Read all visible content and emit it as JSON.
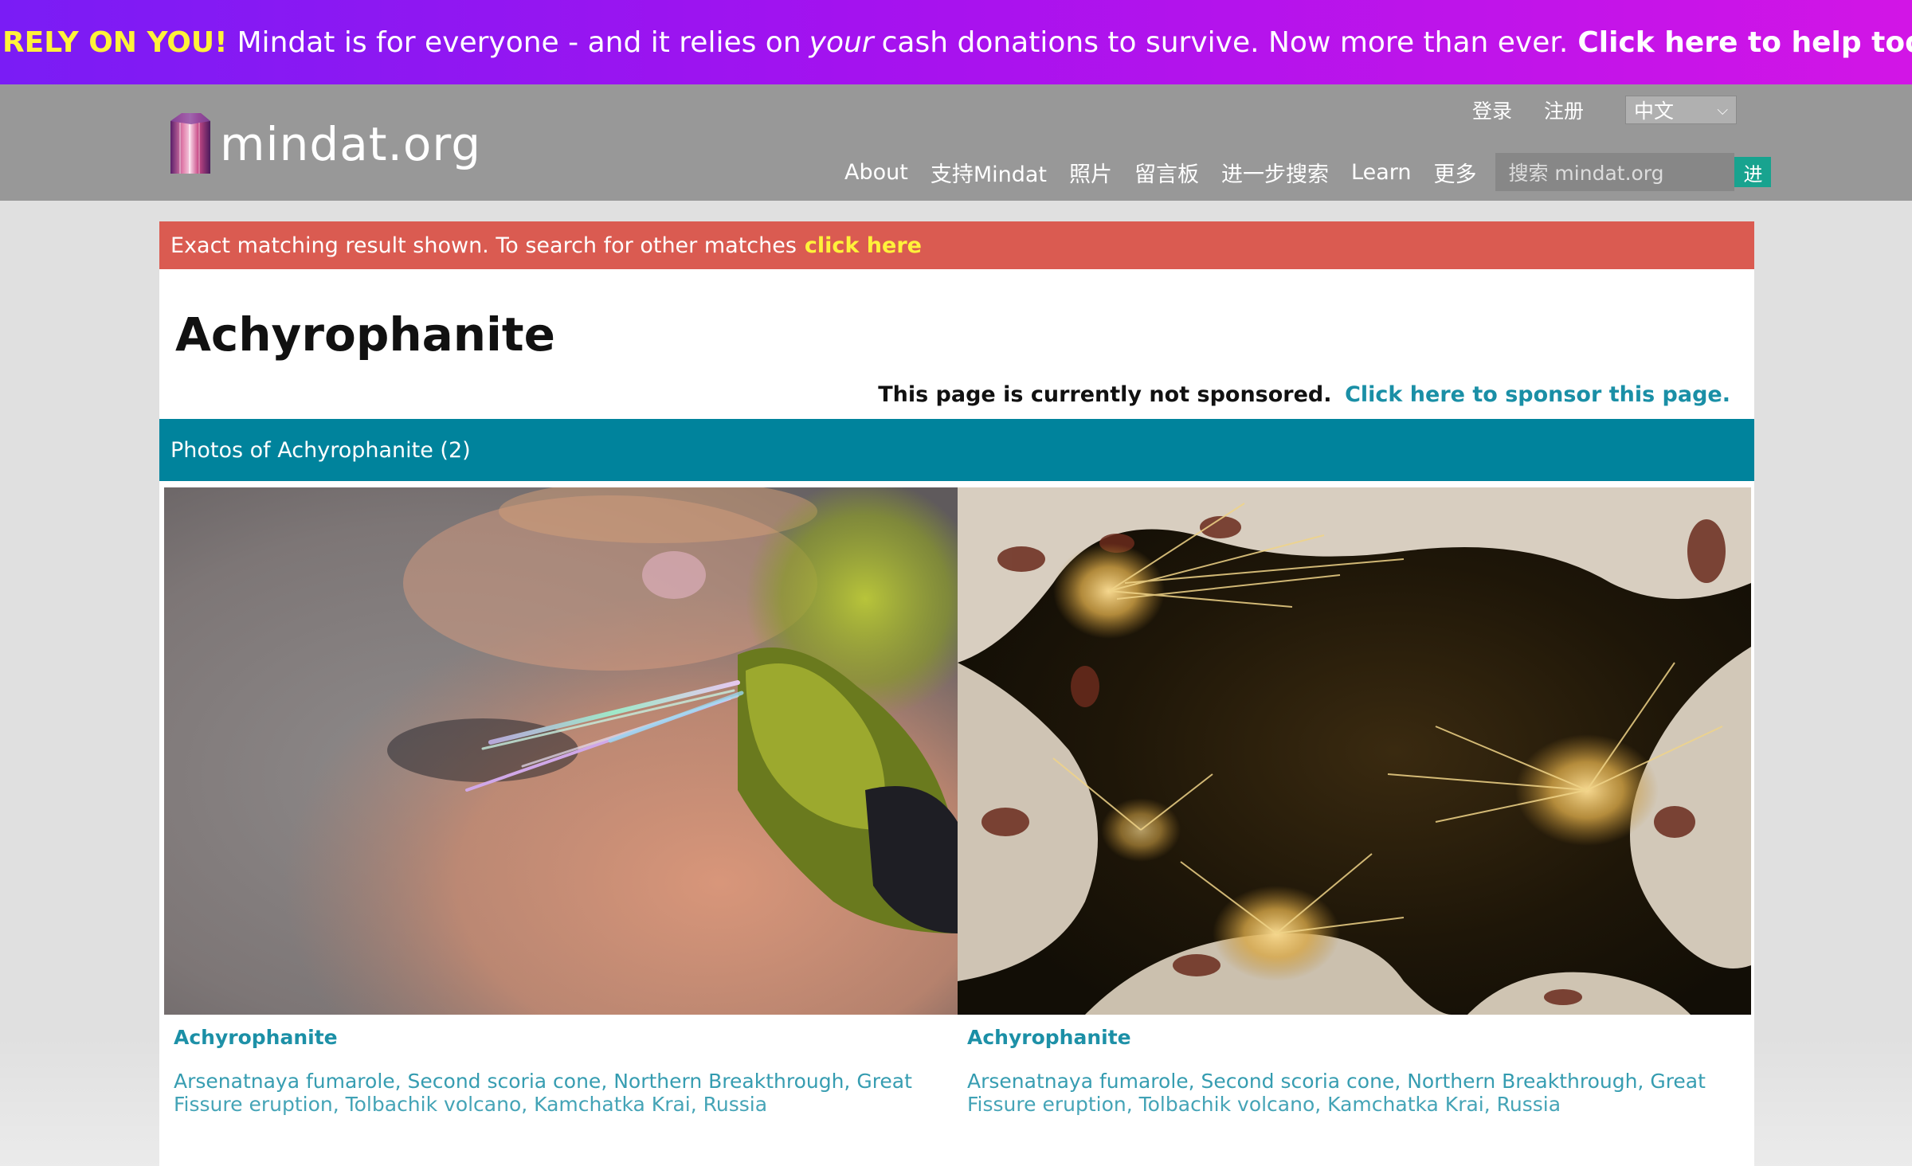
{
  "donation_banner": {
    "alert": "WE RELY ON YOU!",
    "text_before": "Mindat is for everyone - and it relies on",
    "emphasis": "your",
    "text_after": "cash donations to survive. Now more than ever.",
    "cta": "Click here to help today."
  },
  "header": {
    "logo_text": "mindat.org",
    "top_links": {
      "login": "登录",
      "register": "注册"
    },
    "language": "中文",
    "nav": [
      "About",
      "支持Mindat",
      "照片",
      "留言板",
      "进一步搜索",
      "Learn",
      "更多"
    ],
    "search": {
      "placeholder": "搜索 mindat.org",
      "button": "进"
    }
  },
  "notice": {
    "text": "Exact matching result shown. To search for other matches",
    "link": "click here"
  },
  "page": {
    "title": "Achyrophanite",
    "sponsor_text": "This page is currently not sponsored.",
    "sponsor_link": "Click here to sponsor this page."
  },
  "photos_section": {
    "heading": "Photos of Achyrophanite (2)",
    "items": [
      {
        "name": "Achyrophanite",
        "locality": "Arsenatnaya fumarole, Second scoria cone, Northern Breakthrough, Great Fissure eruption, Tolbachik volcano, Kamchatka Krai, Russia"
      },
      {
        "name": "Achyrophanite",
        "locality": "Arsenatnaya fumarole, Second scoria cone, Northern Breakthrough, Great Fissure eruption, Tolbachik volcano, Kamchatka Krai, Russia"
      }
    ]
  },
  "colors": {
    "banner_purple": "#7a1cf5",
    "banner_magenta": "#d215e6",
    "alert_yellow": "#fff23a",
    "header_gray": "#989898",
    "notice_red": "#da5b51",
    "section_teal": "#00839c",
    "link_teal": "#1a8fa6",
    "search_green": "#18a38f"
  }
}
